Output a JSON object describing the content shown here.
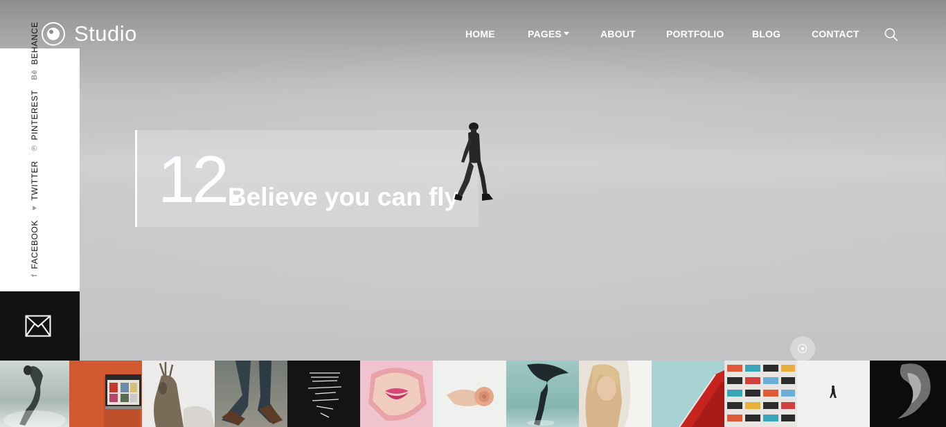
{
  "brand": {
    "name": "Studio"
  },
  "nav": {
    "items": [
      {
        "label": "HOME"
      },
      {
        "label": "PAGES",
        "has_dropdown": true
      },
      {
        "label": "ABOUT"
      },
      {
        "label": "PORTFOLIO"
      },
      {
        "label": "BLOG"
      },
      {
        "label": "CONTACT"
      }
    ],
    "search_icon": "search-icon"
  },
  "social": {
    "links": [
      {
        "label": "FACEBOOK",
        "icon": "f"
      },
      {
        "label": "TWITTER",
        "icon": "♥"
      },
      {
        "label": "PINTEREST",
        "icon": "℗"
      },
      {
        "label": "BEHANCE",
        "icon": "Bē"
      }
    ],
    "mail_icon": "envelope-icon"
  },
  "hero": {
    "number": "12.",
    "title": "Believe you can fly"
  },
  "thumbnails": [
    {
      "subject": "dancer"
    },
    {
      "subject": "window"
    },
    {
      "subject": "deer"
    },
    {
      "subject": "shoes"
    },
    {
      "subject": "light-lines"
    },
    {
      "subject": "lips"
    },
    {
      "subject": "rose-hand"
    },
    {
      "subject": "jumper"
    },
    {
      "subject": "woman-curtain"
    },
    {
      "subject": "red-building"
    },
    {
      "subject": "balconies"
    },
    {
      "subject": "walker"
    },
    {
      "subject": "smoke"
    }
  ],
  "colors": {
    "sidebar_bg": "#ffffff",
    "mail_bg": "#121212",
    "text_light": "#ffffff"
  }
}
